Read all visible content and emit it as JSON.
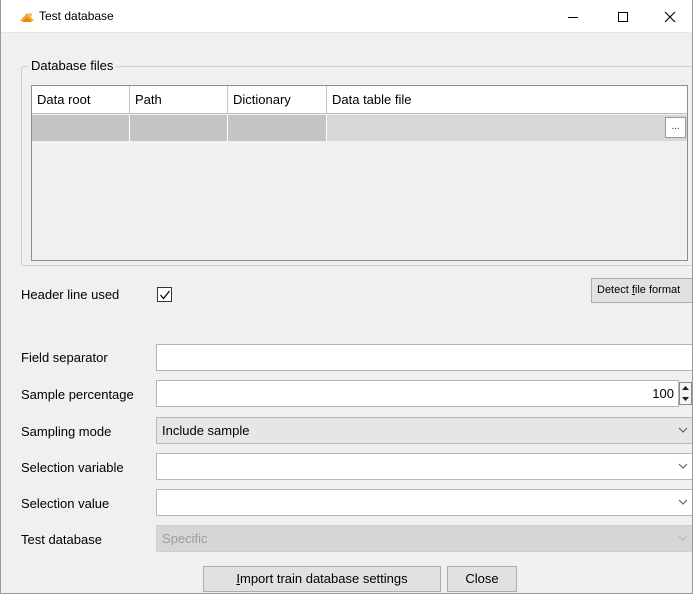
{
  "window": {
    "title": "Test database"
  },
  "database_files": {
    "group_title": "Database files",
    "columns": [
      "Data root",
      "Path",
      "Dictionary",
      "Data table file"
    ],
    "browse_label": "..."
  },
  "detect_button": {
    "pre": "Detect ",
    "mnemonic": "f",
    "post": "ile format"
  },
  "form": {
    "header_line_used": {
      "label": "Header line used",
      "checked": true
    },
    "field_separator": {
      "label": "Field separator",
      "value": ""
    },
    "sample_percentage": {
      "label": "Sample percentage",
      "value": "100"
    },
    "sampling_mode": {
      "label": "Sampling mode",
      "value": "Include sample"
    },
    "selection_variable": {
      "label": "Selection variable",
      "value": ""
    },
    "selection_value": {
      "label": "Selection value",
      "value": ""
    },
    "test_database": {
      "label": "Test database",
      "value": "Specific"
    }
  },
  "buttons": {
    "import_mnemonic": "I",
    "import_rest": "mport train database settings",
    "close": "Close"
  },
  "colors": {
    "accent_icon": "#f5a623",
    "disabled_text": "#9d9d9d"
  }
}
